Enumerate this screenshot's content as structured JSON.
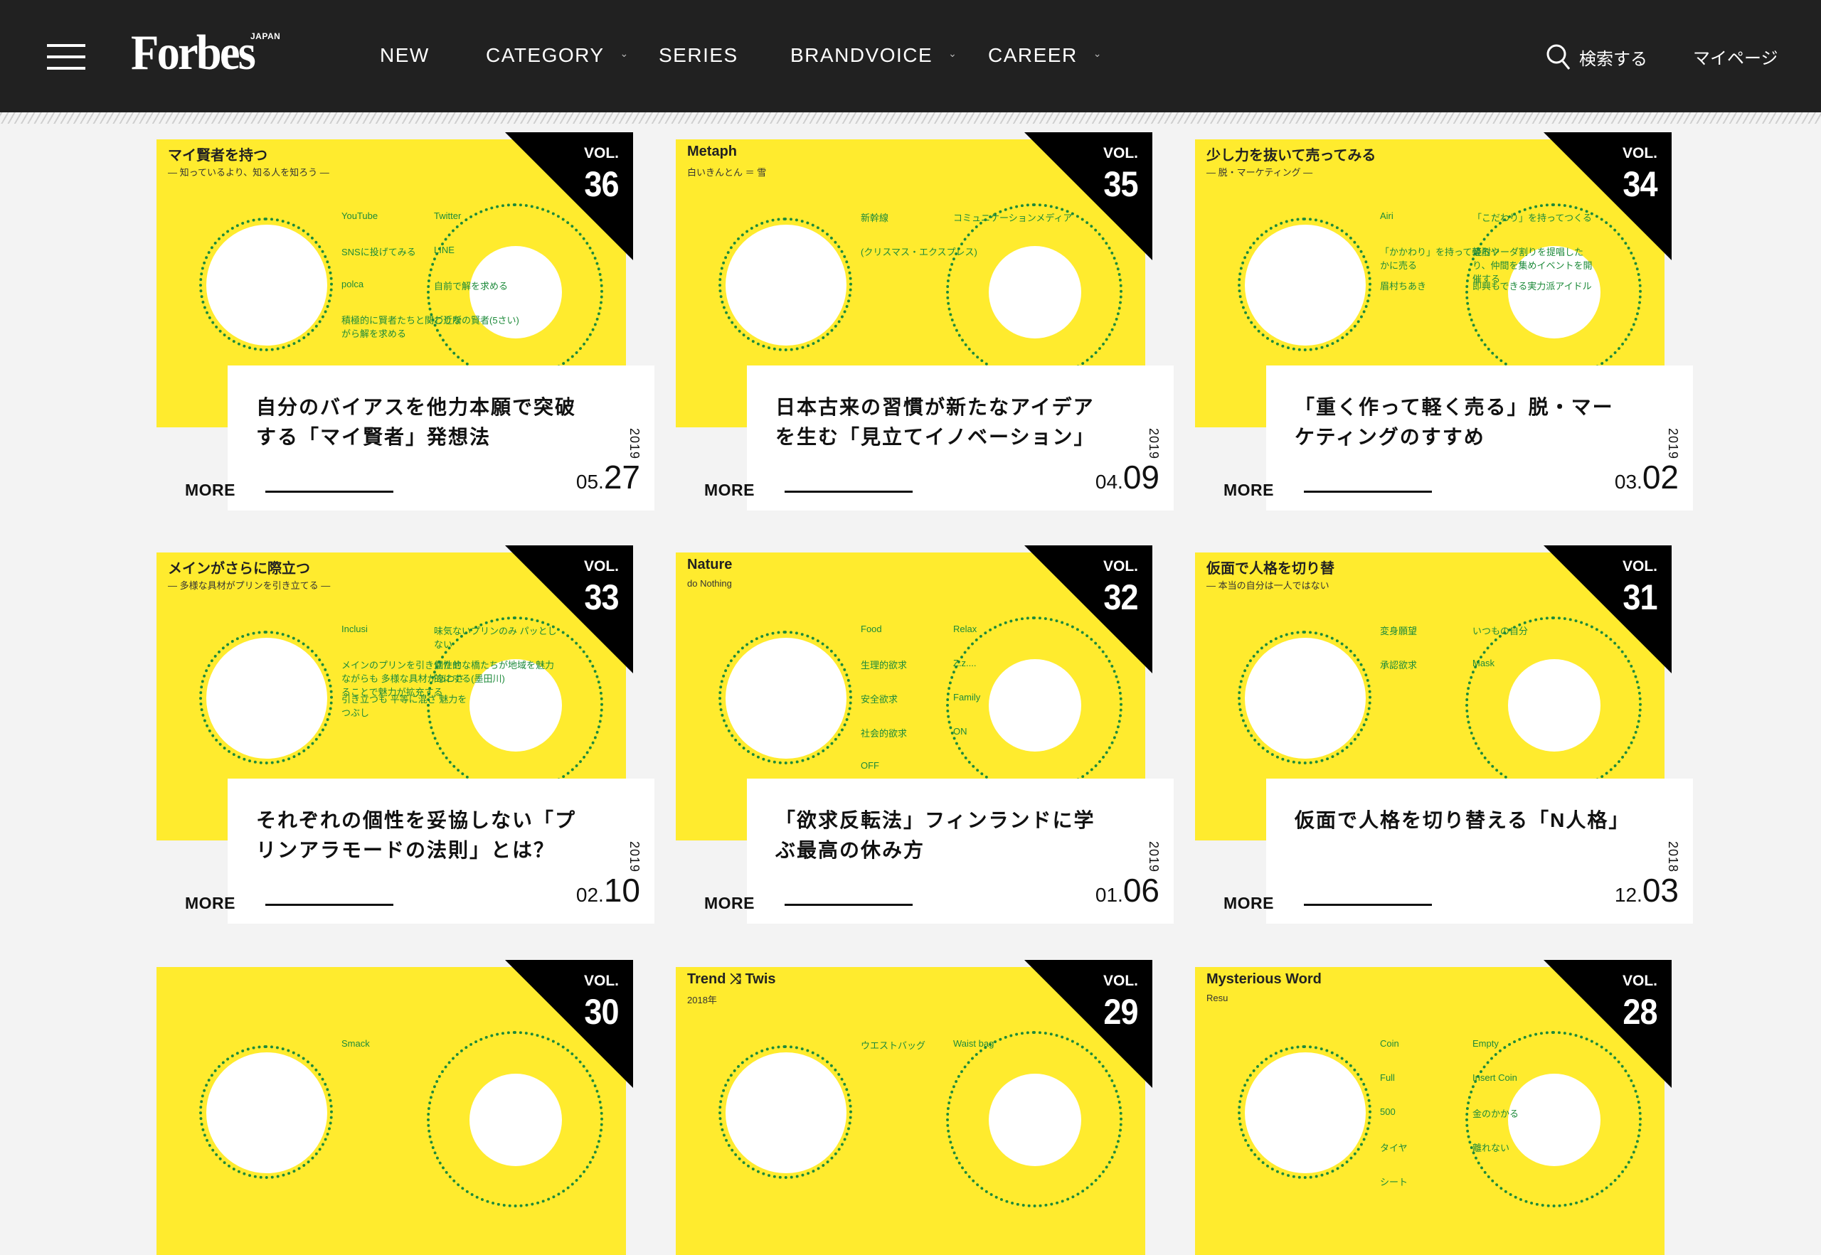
{
  "header": {
    "menu_icon": "hamburger-menu-icon",
    "logo": {
      "word": "Forbes",
      "edition": "JAPAN"
    },
    "nav": [
      {
        "label": "NEW",
        "has_dropdown": false
      },
      {
        "label": "CATEGORY",
        "has_dropdown": true
      },
      {
        "label": "SERIES",
        "has_dropdown": false
      },
      {
        "label": "BRANDVOICE",
        "has_dropdown": true
      },
      {
        "label": "CAREER",
        "has_dropdown": true
      }
    ],
    "dropdown_glyph": "⌄",
    "search": {
      "icon": "search-icon",
      "label": "検索する"
    },
    "mypage_label": "マイページ"
  },
  "colors": {
    "header_bg": "#212121",
    "page_bg": "#f3f3f3",
    "tile_yellow": "#ffeb2e",
    "illustration_green": "#1d8a3a",
    "badge_black": "#000000"
  },
  "more_label": "MORE",
  "articles": [
    {
      "vol_label": "VOL.",
      "vol": "36",
      "title": "自分のバイアスを他力本願で突破する「マイ賢者」発想法",
      "year": "2019",
      "month": "05.",
      "day": "27",
      "illustration": {
        "heading": "マイ賢者を持つ",
        "subheading": "― 知っているより、知る人を知ろう ―",
        "labels": [
          "YouTube",
          "Twitter",
          "SNSに投げてみる",
          "LINE",
          "polca",
          "自前で解を求める",
          "積極的に賢者たちと関わりながら解を求める",
          "ご近所の賢者(5さい)"
        ]
      }
    },
    {
      "vol_label": "VOL.",
      "vol": "35",
      "title": "日本古来の習慣が新たなアイデアを生む「見立てイノベーション」",
      "year": "2019",
      "month": "04.",
      "day": "09",
      "illustration": {
        "heading": "Metaph",
        "subheading": "白いきんとん ＝ 雪",
        "labels": [
          "新幹線",
          "コミュニケーションメディア",
          "(クリスマス・エクスプレス)"
        ]
      }
    },
    {
      "vol_label": "VOL.",
      "vol": "34",
      "title": "「重く作って軽く売る」脱・マーケティングのすすめ",
      "year": "2019",
      "month": "03.",
      "day": "02",
      "illustration": {
        "heading": "少し力を抜いて売ってみる",
        "subheading": "― 脱・マーケティング ―",
        "labels": [
          "Airi",
          "「こだわり」を持ってつくる",
          "「かかわり」を持って軽ろやかに売る",
          "焼酎ソーダ割りを提唱したり、仲間を集めイベントを開催する",
          "眉村ちあき",
          "即興もできる実力派アイドル"
        ]
      }
    },
    {
      "vol_label": "VOL.",
      "vol": "33",
      "title": "それぞれの個性を妥協しない「プリンアラモードの法則」とは？",
      "year": "2019",
      "month": "02.",
      "day": "10",
      "illustration": {
        "heading": "メインがさらに際立つ",
        "subheading": "― 多様な具材がプリンを引き立てる ―",
        "labels": [
          "Inclusi",
          "味気ないプリンのみ パッとしない",
          "メインのプリンを引き立たせながらも 多様な具材があわさることで魅力が拡充する",
          "個性的な橋たちが地域を魅力的にする(墨田川)",
          "引き立つも 平等に混ざ 魅力をつぶし"
        ]
      }
    },
    {
      "vol_label": "VOL.",
      "vol": "32",
      "title": "「欲求反転法」フィンランドに学ぶ最高の休み方",
      "year": "2019",
      "month": "01.",
      "day": "06",
      "illustration": {
        "heading": "Nature",
        "subheading": "do Nothing",
        "labels": [
          "Food",
          "Relax",
          "生理的欲求",
          "Z.z....",
          "安全欲求",
          "Family",
          "社会的欲求",
          "ON",
          "OFF"
        ]
      }
    },
    {
      "vol_label": "VOL.",
      "vol": "31",
      "title": "仮面で人格を切り替える「N人格」",
      "year": "2018",
      "month": "12.",
      "day": "03",
      "illustration": {
        "heading": "仮面で人格を切り替",
        "subheading": "― 本当の自分は一人ではない",
        "labels": [
          "変身願望",
          "いつもの自分",
          "承認欲求",
          "Mask"
        ]
      }
    },
    {
      "vol_label": "VOL.",
      "vol": "30",
      "title": "",
      "illustration": {
        "heading": "",
        "subheading": "",
        "labels": [
          "Smack"
        ]
      }
    },
    {
      "vol_label": "VOL.",
      "vol": "29",
      "title": "",
      "illustration": {
        "heading": "Trend ⤨ Twis",
        "subheading": "2018年",
        "labels": [
          "ウエストバッグ",
          "Waist bag"
        ]
      }
    },
    {
      "vol_label": "VOL.",
      "vol": "28",
      "title": "",
      "illustration": {
        "heading": "Mysterious Word",
        "subheading": "Resu",
        "labels": [
          "Coin",
          "Empty",
          "Full",
          "Insert Coin",
          "500",
          "金のかかる",
          "タイヤ",
          "離れない",
          "シート"
        ]
      }
    }
  ]
}
